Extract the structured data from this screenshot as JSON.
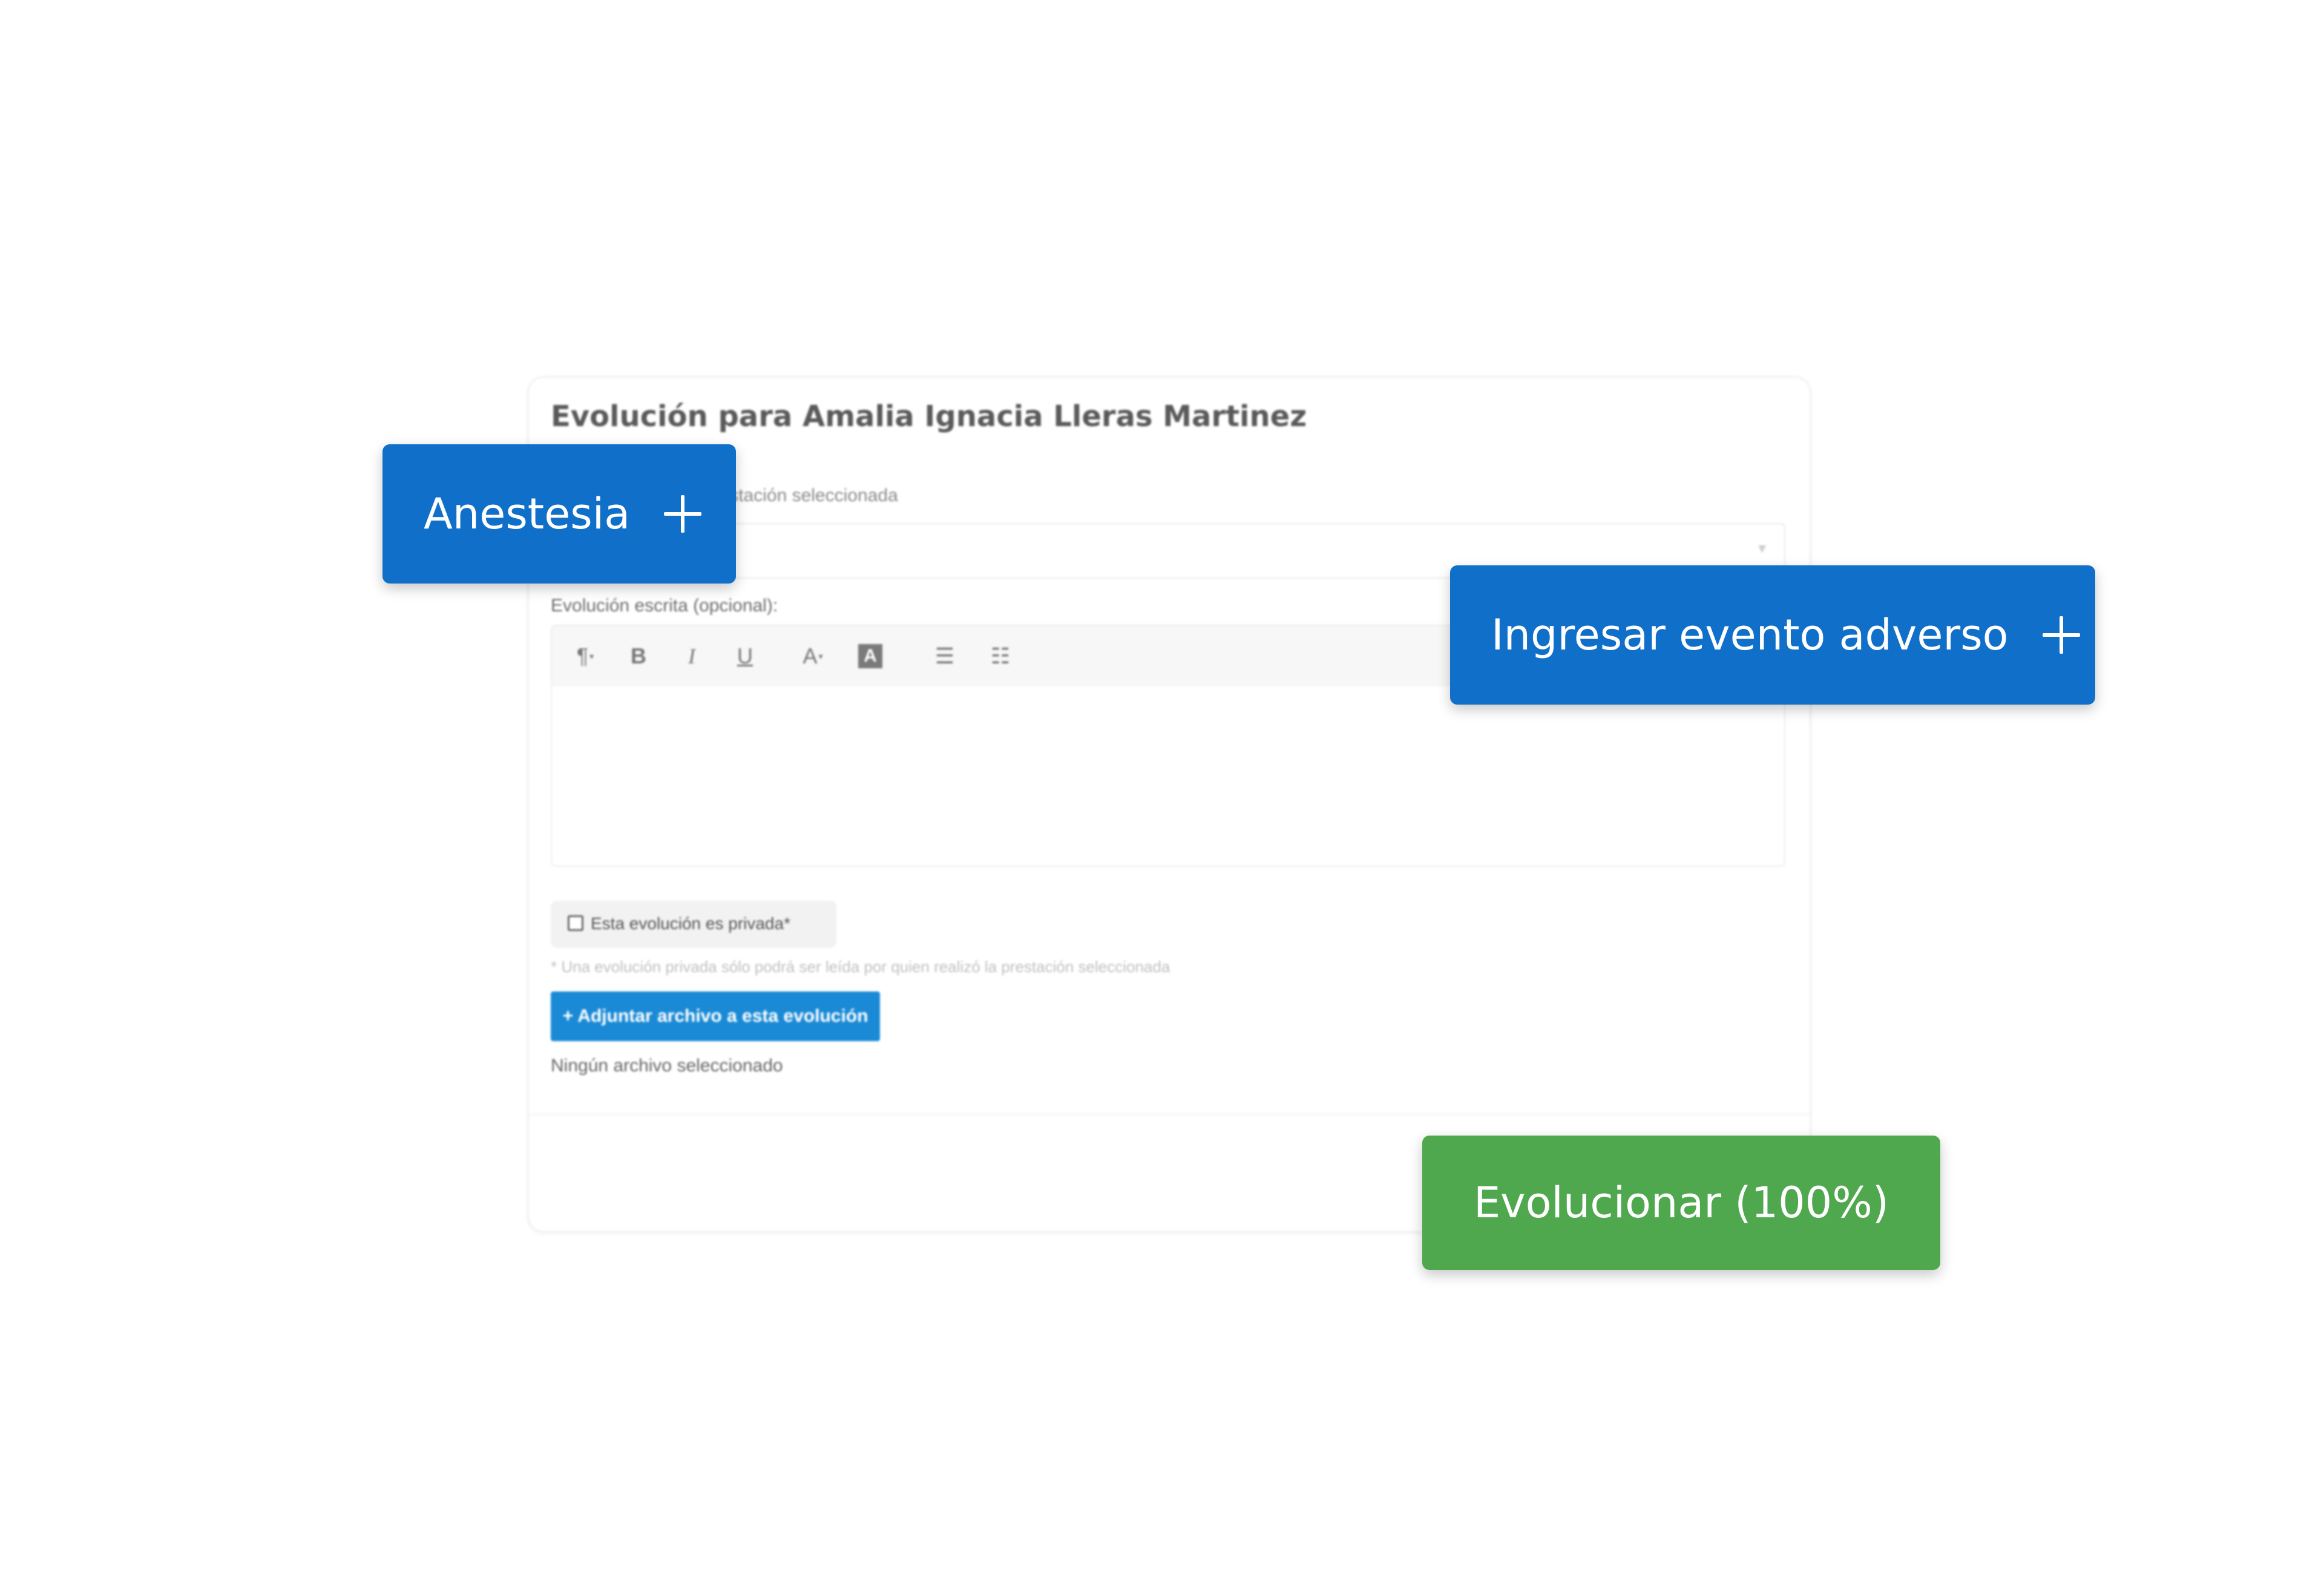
{
  "card": {
    "title": "Evolución para Amalia Ignacia Lleras Martinez",
    "professional_label": "onal que realizó la prestación seleccionada",
    "written_label": "Evolución escrita (opcional):",
    "private_checkbox_label": "Esta evolución es privada*",
    "private_note": "* Una evolución privada sólo podrá ser leída por quien realizó la prestación seleccionada",
    "attach_button_label": "+ Adjuntar archivo a esta evolución",
    "no_file_text": "Ningún archivo seleccionado"
  },
  "toolbar": {
    "paragraph": "¶",
    "bold": "B",
    "italic": "I",
    "underline": "U",
    "font_color": "A",
    "highlight": "A",
    "bullet_list": "☰",
    "numbered_list": "☷"
  },
  "buttons": {
    "anestesia": "Anestesia",
    "evento_adverso": "Ingresar evento adverso",
    "evolucionar": "Evolucionar (100%)"
  },
  "colors": {
    "primary_blue": "#0f6fc9",
    "attach_blue": "#1a8ad6",
    "success_green": "#4fa84e"
  }
}
